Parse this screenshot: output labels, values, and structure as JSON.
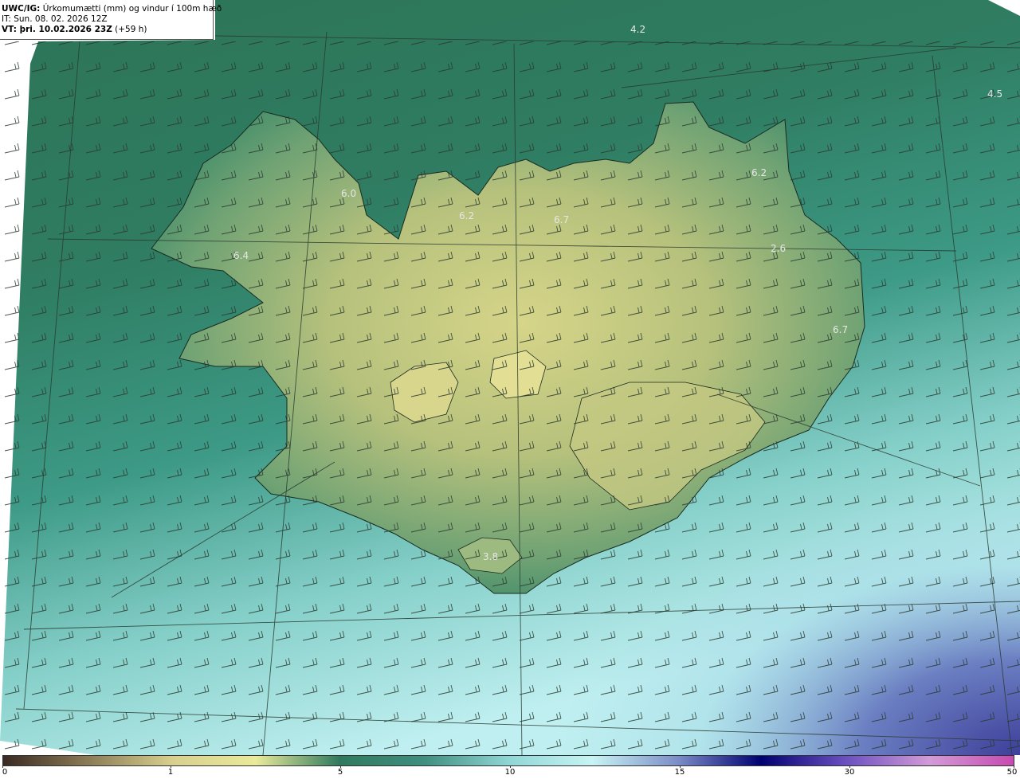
{
  "header": {
    "product_prefix": "UWC/IG:",
    "product_title": " Úrkomumætti (mm) og vindur í 100m hæð",
    "init_time": "IT: Sun. 08. 02. 2026 12Z",
    "valid_prefix": "VT: þri. 10.02.2026 23Z",
    "valid_suffix": " (+59 h)"
  },
  "precip_labels": [
    {
      "text": "4.2"
    },
    {
      "text": "4.5"
    },
    {
      "text": "6.2"
    },
    {
      "text": "6.0"
    },
    {
      "text": "6.2"
    },
    {
      "text": "6.7"
    },
    {
      "text": "2.6"
    },
    {
      "text": "6.4"
    },
    {
      "text": "6.7"
    },
    {
      "text": "3.8"
    }
  ],
  "colorbar": {
    "ticks": [
      "0",
      "1",
      "5",
      "10",
      "15",
      "30",
      "50"
    ],
    "colors": [
      "#3b2a22",
      "#8a7a55",
      "#d8cf8e",
      "#eaea9a",
      "#2f7a5e",
      "#3f8f80",
      "#8fd6d6",
      "#c8f4f4",
      "#7c8ec8",
      "#000072",
      "#6a4fc0",
      "#d39bd8",
      "#c64ab0"
    ]
  }
}
